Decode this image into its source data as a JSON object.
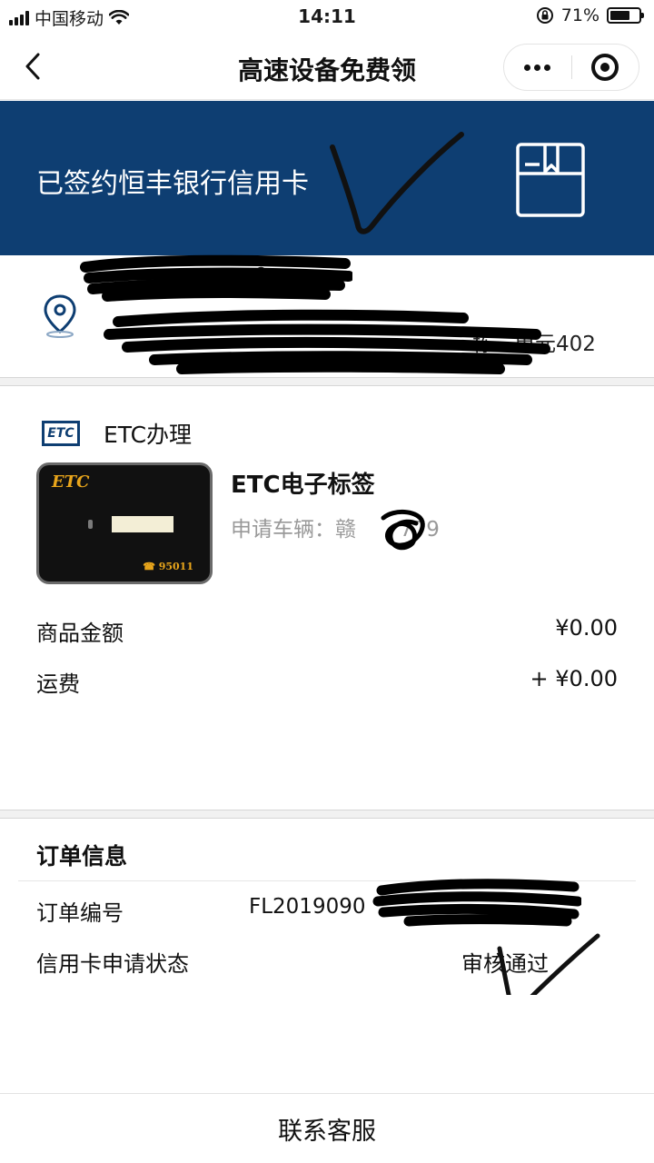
{
  "status_bar": {
    "carrier": "中国移动",
    "time": "14:11",
    "battery_percent": "71%",
    "battery_level": 0.71
  },
  "nav": {
    "title": "高速设备免费领",
    "back_icon": "chevron-left-icon",
    "more_icon": "more-dots-icon",
    "close_icon": "target-icon"
  },
  "banner": {
    "text": "已签约恒丰银行信用卡",
    "icon": "package-box-icon",
    "background": "#0e3e72"
  },
  "address": {
    "name_visible": "0",
    "detail_visible": "栋二单元402",
    "icon": "location-pin-icon"
  },
  "etc": {
    "section_label": "ETC办理",
    "badge": "ETC",
    "product_name": "ETC电子标签",
    "vehicle_prefix": "申请车辆：",
    "vehicle_plate_visible": "赣",
    "vehicle_suffix": "779",
    "device_logo": "ETC",
    "device_phone": "☎ 95011",
    "goods_amount_label": "商品金额",
    "goods_amount_value": "¥0.00",
    "shipping_label": "运费",
    "shipping_value": "+ ¥0.00"
  },
  "order": {
    "title": "订单信息",
    "number_label": "订单编号",
    "number_value_visible": "FL2019090",
    "status_label": "信用卡申请状态",
    "status_value": "审核通过"
  },
  "footer": {
    "contact_label": "联系客服"
  }
}
